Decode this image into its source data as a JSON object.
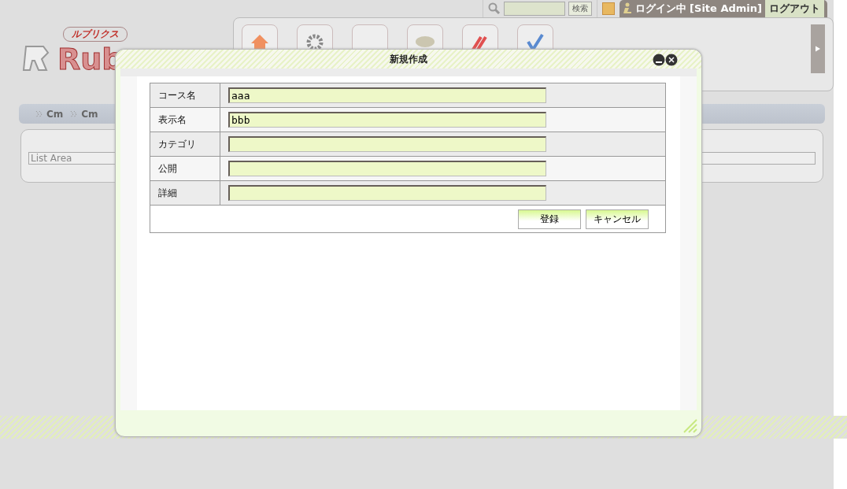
{
  "header": {
    "search_button": "検索",
    "login_status": "ログイン中 [Site Admin]",
    "logout": "ログアウト"
  },
  "logo": {
    "tagline": "ルブリクス",
    "name": "Rub"
  },
  "breadcrumbs": [
    "Cm",
    "Cm"
  ],
  "list_area": {
    "label": "List Area"
  },
  "dialog": {
    "title": "新規作成",
    "fields": [
      {
        "label": "コース名",
        "value": "aaa"
      },
      {
        "label": "表示名",
        "value": "bbb"
      },
      {
        "label": "カテゴリ"
      },
      {
        "label": "公開"
      },
      {
        "label": "詳細"
      }
    ],
    "buttons": [
      "登録",
      "キャンセル"
    ]
  }
}
